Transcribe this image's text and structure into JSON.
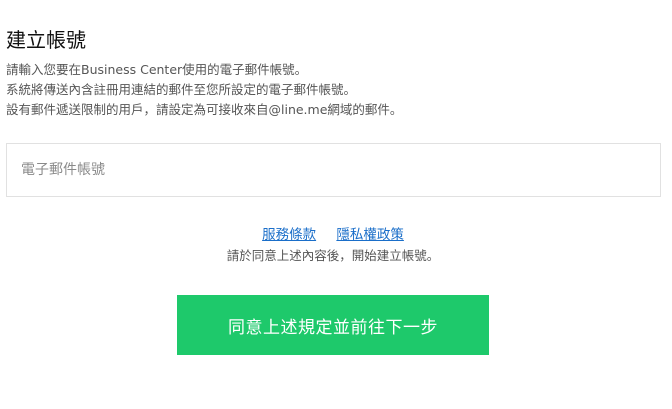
{
  "page": {
    "title": "建立帳號",
    "description": [
      "請輸入您要在Business Center使用的電子郵件帳號。",
      "系統將傳送內含註冊用連結的郵件至您所設定的電子郵件帳號。",
      "設有郵件遞送限制的用戶，請設定為可接收來自@line.me網域的郵件。"
    ]
  },
  "form": {
    "email": {
      "value": "",
      "placeholder": "電子郵件帳號"
    }
  },
  "links": {
    "terms": "服務條款",
    "privacy": "隱私權政策"
  },
  "consent_text": "請於同意上述內容後，開始建立帳號。",
  "submit_label": "同意上述規定並前往下一步",
  "colors": {
    "accent": "#1ec96b",
    "link": "#1a6ec9",
    "text": "#111111",
    "muted": "#555555",
    "border": "#e1e1e1"
  }
}
